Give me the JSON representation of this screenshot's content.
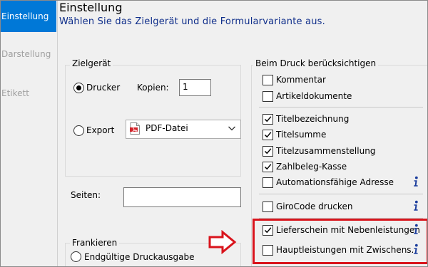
{
  "sidebar": {
    "items": [
      {
        "label": "Einstellung",
        "active": true
      },
      {
        "label": "Darstellung",
        "active": false
      },
      {
        "label": "Etikett",
        "active": false
      }
    ]
  },
  "header": {
    "title": "Einstellung",
    "subtitle": "Wählen Sie das Zielgerät und die Formularvariante aus."
  },
  "zielgeraet": {
    "group_title": "Zielgerät",
    "drucker_label": "Drucker",
    "drucker_selected": true,
    "kopien_label": "Kopien:",
    "kopien_value": "1",
    "export_label": "Export",
    "export_selected": false,
    "export_format": "PDF-Datei"
  },
  "seiten": {
    "label": "Seiten:",
    "value": ""
  },
  "frankieren": {
    "group_title": "Frankieren",
    "option_label": "Endgültige Druckausgabe"
  },
  "beim_druck": {
    "group_title": "Beim Druck berücksichtigen",
    "section1": [
      {
        "label": "Kommentar",
        "checked": false,
        "info": false
      },
      {
        "label": "Artikeldokumente",
        "checked": false,
        "info": false
      }
    ],
    "section2": [
      {
        "label": "Titelbezeichnung",
        "checked": true,
        "info": false
      },
      {
        "label": "Titelsumme",
        "checked": true,
        "info": false
      },
      {
        "label": "Titelzusammenstellung",
        "checked": true,
        "info": false
      },
      {
        "label": "Zahlbeleg-Kasse",
        "checked": true,
        "info": false
      },
      {
        "label": "Automationsfähige Adresse",
        "checked": false,
        "info": true
      }
    ],
    "section3": [
      {
        "label": "GiroCode drucken",
        "checked": false,
        "info": true
      }
    ],
    "section4": [
      {
        "label": "Lieferschein mit Nebenleistungen",
        "checked": true,
        "info": true
      },
      {
        "label": "Hauptleistungen mit Zwischens.",
        "checked": false,
        "info": true
      }
    ]
  },
  "colors": {
    "accent": "#0078d7",
    "subtitle": "#0f2e8a",
    "highlight": "#d9141c",
    "info_icon": "#1a3c9c"
  },
  "icons": {
    "pdf": "pdf-file-icon",
    "chevron": "chevron-down-icon",
    "info": "info-icon",
    "arrow": "red-arrow-right-icon",
    "check": "checkmark-icon"
  }
}
